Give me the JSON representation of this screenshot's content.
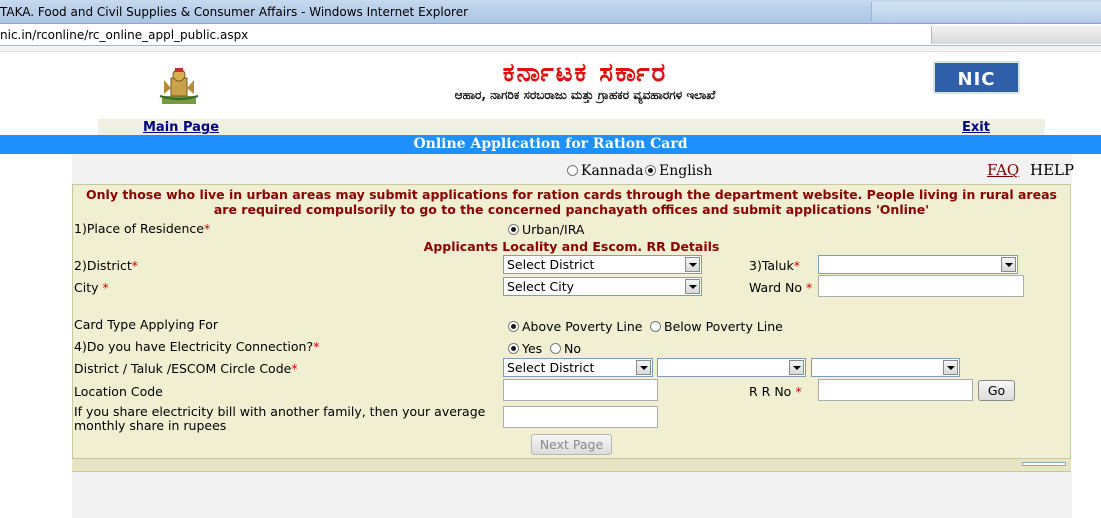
{
  "window": {
    "title": "TAKA. Food and Civil Supplies & Consumer Affairs - Windows Internet Explorer",
    "address": "nic.in/rconline/rc_online_appl_public.aspx"
  },
  "header": {
    "kannada_title": "ಕರ್ನಾಟಕ ಸರ್ಕಾರ",
    "kannada_subtitle": "ಆಹಾರ, ನಾಗರಿಕ ಸರಬರಾಜು ಮತ್ತು ಗ್ರಾಹಕರ ವ್ಯವಹಾರಗಳ ಇಲಾಖೆ",
    "logo_text": "NIC"
  },
  "nav": {
    "main_page": "Main Page",
    "exit": "Exit"
  },
  "banner": "Online Application for Ration Card",
  "language": {
    "kannada": "Kannada",
    "english": "English",
    "selected": "English",
    "faq": "FAQ",
    "help": "HELP"
  },
  "notice": "Only those who live in urban areas may submit applications for ration cards through the department website. People living in rural areas are required compulsorily to go to the concerned panchayath offices and submit applications 'Online'",
  "form": {
    "residence_label": "1)Place of Residence",
    "residence_option": "Urban/IRA",
    "section_title": "Applicants Locality and Escom. RR Details",
    "district_label": "2)District",
    "district_value": "Select District",
    "taluk_label": "3)Taluk",
    "taluk_value": "",
    "city_label": "City",
    "city_value": "Select City",
    "ward_label": "Ward No",
    "ward_value": "",
    "card_type_label": "Card Type Applying For",
    "card_apl": "Above Poverty Line",
    "card_bpl": "Below Poverty Line",
    "electricity_label": "4)Do you have Electricity Connection?",
    "elec_yes": "Yes",
    "elec_no": "No",
    "escom_label": "District / Taluk /ESCOM Circle Code",
    "escom_district": "Select District",
    "escom_taluk": "",
    "escom_circle": "",
    "location_label": "Location Code",
    "location_value": "",
    "rr_label": "R R No",
    "rr_value": "",
    "go_button": "Go",
    "share_label_1": "If you share electricity bill with another family, then your average",
    "share_label_2": "monthly share in rupees",
    "share_value": "",
    "next_button": "Next Page"
  },
  "colors": {
    "banner": "#1e90ff",
    "form_bg": "#f0efd2",
    "notice": "#8b0000",
    "required": "#d00000"
  }
}
